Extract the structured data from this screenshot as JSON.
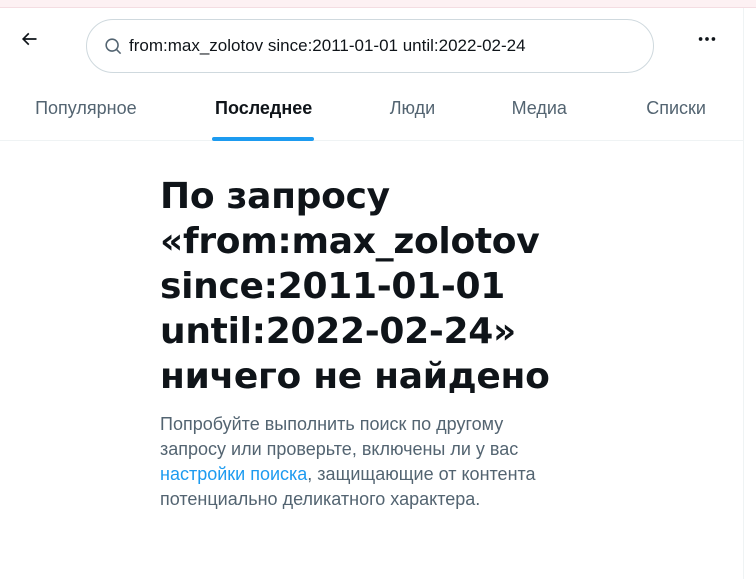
{
  "header": {
    "search_value": "from:max_zolotov since:2011-01-01 until:2022-02-24",
    "back_icon": "arrow-left-icon",
    "more_icon": "more-dots-icon",
    "search_icon": "magnifier-icon"
  },
  "tabs": [
    {
      "label": "Популярное",
      "active": false
    },
    {
      "label": "Последнее",
      "active": true
    },
    {
      "label": "Люди",
      "active": false
    },
    {
      "label": "Медиа",
      "active": false
    },
    {
      "label": "Списки",
      "active": false
    }
  ],
  "empty": {
    "title_line1": "По запросу",
    "title_line2": "«from:max_zolotov",
    "title_line3": "since:2011-01-01",
    "title_line4": "until:2022-02-24»",
    "title_line5": "ничего не найдено",
    "desc_before": "Попробуйте выполнить поиск по другому запросу или проверьте, включены ли у вас ",
    "desc_link": "настройки поиска",
    "desc_after": ", защищающие от контента потенциально деликатного характера."
  },
  "colors": {
    "accent": "#1d9bf0",
    "text_primary": "#0f1419",
    "text_secondary": "#536471",
    "border": "#cfd9de"
  }
}
